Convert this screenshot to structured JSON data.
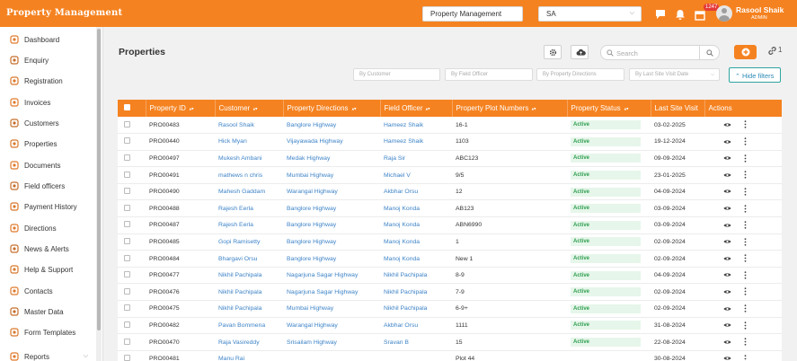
{
  "app": {
    "brand": "Property Management",
    "company_select": "Property Management",
    "code_select": "SA",
    "notification_badge": "1247",
    "user_name": "Rasool Shaik",
    "user_role": "ADMIN"
  },
  "sidebar": {
    "items": [
      {
        "label": "Dashboard",
        "icon": "dashboard-icon"
      },
      {
        "label": "Enquiry",
        "icon": "enquiry-icon"
      },
      {
        "label": "Registration",
        "icon": "registration-icon"
      },
      {
        "label": "Invoices",
        "icon": "invoices-icon"
      },
      {
        "label": "Customers",
        "icon": "customers-icon"
      },
      {
        "label": "Properties",
        "icon": "properties-icon"
      },
      {
        "label": "Documents",
        "icon": "documents-icon"
      },
      {
        "label": "Field officers",
        "icon": "field-officers-icon"
      },
      {
        "label": "Payment History",
        "icon": "payment-history-icon"
      },
      {
        "label": "Directions",
        "icon": "directions-icon"
      },
      {
        "label": "News & Alerts",
        "icon": "news-alerts-icon"
      },
      {
        "label": "Help & Support",
        "icon": "help-support-icon"
      },
      {
        "label": "Contacts",
        "icon": "contacts-icon"
      },
      {
        "label": "Master Data",
        "icon": "master-data-icon"
      },
      {
        "label": "Form Templates",
        "icon": "form-templates-icon"
      },
      {
        "label": "Reports",
        "icon": "reports-icon"
      }
    ]
  },
  "main": {
    "title": "Properties",
    "search_placeholder": "Search",
    "link_count": "1",
    "filters": [
      "By Customer",
      "By Field Officer",
      "By Property Directions",
      "By Last Site Visit Date"
    ],
    "hide_filters_label": "Hide filters"
  },
  "table": {
    "columns": [
      "Property ID",
      "Customer",
      "Property Directions",
      "Field Officer",
      "Property Plot Numbers",
      "Property Status",
      "Last Site Visit",
      "Actions"
    ],
    "rows": [
      [
        "PRO00483",
        "Rasool Shaik",
        "Banglore Highway",
        "Hameez Shaik",
        "16-1",
        "Active",
        "03-02-2025"
      ],
      [
        "PRO00440",
        "Hick Myan",
        "Vijayawada Highway",
        "Hameez Shaik",
        "1103",
        "Active",
        "19-12-2024"
      ],
      [
        "PRO00497",
        "Mukesh Ambani",
        "Medak Highway",
        "Raja Sir",
        "ABC123",
        "Active",
        "09-09-2024"
      ],
      [
        "PRO00491",
        "mathews n chris",
        "Mumbai Highway",
        "Michael V",
        "9/5",
        "Active",
        "23-01-2025"
      ],
      [
        "PRO00490",
        "Mahesh Gaddam",
        "Warangal Highway",
        "Akbhar Orsu",
        "12",
        "Active",
        "04-09-2024"
      ],
      [
        "PRO00488",
        "Rajesh Eerla",
        "Banglore Highway",
        "Manoj Konda",
        "AB123",
        "Active",
        "03-09-2024"
      ],
      [
        "PRO00487",
        "Rajesh Eerla",
        "Banglore Highway",
        "Manoj Konda",
        "ABN6990",
        "Active",
        "03-09-2024"
      ],
      [
        "PRO00485",
        "Gopi Ramisetty",
        "Banglore Highway",
        "Manoj Konda",
        "1",
        "Active",
        "02-09-2024"
      ],
      [
        "PRO00484",
        "Bhargavi Orsu",
        "Banglore Highway",
        "Manoj Konda",
        "New 1",
        "Active",
        "02-09-2024"
      ],
      [
        "PRO00477",
        "Nikhil Pachipala",
        "Nagarjuna Sagar Highway",
        "Nikhil Pachipala",
        "8-9",
        "Active",
        "04-09-2024"
      ],
      [
        "PRO00476",
        "Nikhil Pachipala",
        "Nagarjuna Sagar Highway",
        "Nikhil Pachipala",
        "7-9",
        "Active",
        "02-09-2024"
      ],
      [
        "PRO00475",
        "Nikhil Pachipala",
        "Mumbai Highway",
        "Nikhil Pachipala",
        "6-9+",
        "Active",
        "02-09-2024"
      ],
      [
        "PRO00482",
        "Pavan Bommena",
        "Warangal Highway",
        "Akbhar Orsu",
        "1111",
        "Active",
        "31-08-2024"
      ],
      [
        "PRO00470",
        "Raja Vasireddy",
        "Srisailam Highway",
        "Sravan B",
        "15",
        "Active",
        "22-08-2024"
      ],
      [
        "PRO00481",
        "Manu Rai",
        "",
        "",
        "Plot 44",
        "",
        "30-08-2024"
      ]
    ]
  },
  "colors": {
    "accent": "#f58220",
    "link": "#3d83c7",
    "active_status": "#2e9e4f"
  }
}
